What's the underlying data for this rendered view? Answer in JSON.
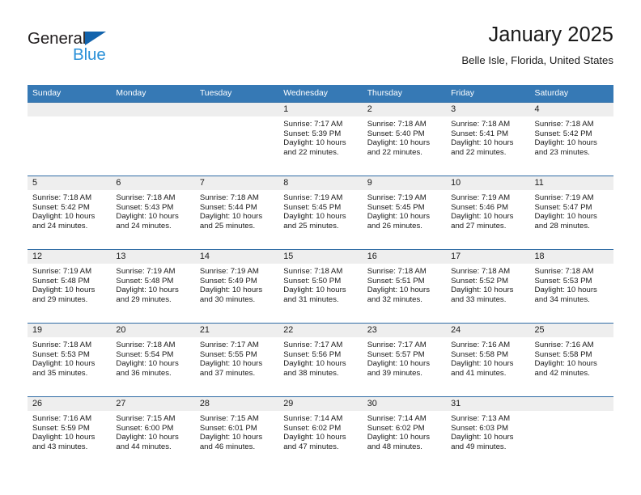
{
  "logo": {
    "word_top": "General",
    "word_bottom": "Blue",
    "triangle_color": "#1263ac",
    "blue_color": "#2a90d8"
  },
  "header": {
    "title": "January 2025",
    "subtitle": "Belle Isle, Florida, United States"
  },
  "theme": {
    "header_blue": "#3679b5",
    "row_border_blue": "#2f6ca5",
    "day_band_gray": "#eeeeee"
  },
  "weekday_headers": [
    "Sunday",
    "Monday",
    "Tuesday",
    "Wednesday",
    "Thursday",
    "Friday",
    "Saturday"
  ],
  "weeks": [
    [
      {
        "day": "",
        "sunrise": "",
        "sunset": "",
        "daylight_line1": "",
        "daylight_line2": ""
      },
      {
        "day": "",
        "sunrise": "",
        "sunset": "",
        "daylight_line1": "",
        "daylight_line2": ""
      },
      {
        "day": "",
        "sunrise": "",
        "sunset": "",
        "daylight_line1": "",
        "daylight_line2": ""
      },
      {
        "day": "1",
        "sunrise": "Sunrise: 7:17 AM",
        "sunset": "Sunset: 5:39 PM",
        "daylight_line1": "Daylight: 10 hours",
        "daylight_line2": "and 22 minutes."
      },
      {
        "day": "2",
        "sunrise": "Sunrise: 7:18 AM",
        "sunset": "Sunset: 5:40 PM",
        "daylight_line1": "Daylight: 10 hours",
        "daylight_line2": "and 22 minutes."
      },
      {
        "day": "3",
        "sunrise": "Sunrise: 7:18 AM",
        "sunset": "Sunset: 5:41 PM",
        "daylight_line1": "Daylight: 10 hours",
        "daylight_line2": "and 22 minutes."
      },
      {
        "day": "4",
        "sunrise": "Sunrise: 7:18 AM",
        "sunset": "Sunset: 5:42 PM",
        "daylight_line1": "Daylight: 10 hours",
        "daylight_line2": "and 23 minutes."
      }
    ],
    [
      {
        "day": "5",
        "sunrise": "Sunrise: 7:18 AM",
        "sunset": "Sunset: 5:42 PM",
        "daylight_line1": "Daylight: 10 hours",
        "daylight_line2": "and 24 minutes."
      },
      {
        "day": "6",
        "sunrise": "Sunrise: 7:18 AM",
        "sunset": "Sunset: 5:43 PM",
        "daylight_line1": "Daylight: 10 hours",
        "daylight_line2": "and 24 minutes."
      },
      {
        "day": "7",
        "sunrise": "Sunrise: 7:18 AM",
        "sunset": "Sunset: 5:44 PM",
        "daylight_line1": "Daylight: 10 hours",
        "daylight_line2": "and 25 minutes."
      },
      {
        "day": "8",
        "sunrise": "Sunrise: 7:19 AM",
        "sunset": "Sunset: 5:45 PM",
        "daylight_line1": "Daylight: 10 hours",
        "daylight_line2": "and 25 minutes."
      },
      {
        "day": "9",
        "sunrise": "Sunrise: 7:19 AM",
        "sunset": "Sunset: 5:45 PM",
        "daylight_line1": "Daylight: 10 hours",
        "daylight_line2": "and 26 minutes."
      },
      {
        "day": "10",
        "sunrise": "Sunrise: 7:19 AM",
        "sunset": "Sunset: 5:46 PM",
        "daylight_line1": "Daylight: 10 hours",
        "daylight_line2": "and 27 minutes."
      },
      {
        "day": "11",
        "sunrise": "Sunrise: 7:19 AM",
        "sunset": "Sunset: 5:47 PM",
        "daylight_line1": "Daylight: 10 hours",
        "daylight_line2": "and 28 minutes."
      }
    ],
    [
      {
        "day": "12",
        "sunrise": "Sunrise: 7:19 AM",
        "sunset": "Sunset: 5:48 PM",
        "daylight_line1": "Daylight: 10 hours",
        "daylight_line2": "and 29 minutes."
      },
      {
        "day": "13",
        "sunrise": "Sunrise: 7:19 AM",
        "sunset": "Sunset: 5:48 PM",
        "daylight_line1": "Daylight: 10 hours",
        "daylight_line2": "and 29 minutes."
      },
      {
        "day": "14",
        "sunrise": "Sunrise: 7:19 AM",
        "sunset": "Sunset: 5:49 PM",
        "daylight_line1": "Daylight: 10 hours",
        "daylight_line2": "and 30 minutes."
      },
      {
        "day": "15",
        "sunrise": "Sunrise: 7:18 AM",
        "sunset": "Sunset: 5:50 PM",
        "daylight_line1": "Daylight: 10 hours",
        "daylight_line2": "and 31 minutes."
      },
      {
        "day": "16",
        "sunrise": "Sunrise: 7:18 AM",
        "sunset": "Sunset: 5:51 PM",
        "daylight_line1": "Daylight: 10 hours",
        "daylight_line2": "and 32 minutes."
      },
      {
        "day": "17",
        "sunrise": "Sunrise: 7:18 AM",
        "sunset": "Sunset: 5:52 PM",
        "daylight_line1": "Daylight: 10 hours",
        "daylight_line2": "and 33 minutes."
      },
      {
        "day": "18",
        "sunrise": "Sunrise: 7:18 AM",
        "sunset": "Sunset: 5:53 PM",
        "daylight_line1": "Daylight: 10 hours",
        "daylight_line2": "and 34 minutes."
      }
    ],
    [
      {
        "day": "19",
        "sunrise": "Sunrise: 7:18 AM",
        "sunset": "Sunset: 5:53 PM",
        "daylight_line1": "Daylight: 10 hours",
        "daylight_line2": "and 35 minutes."
      },
      {
        "day": "20",
        "sunrise": "Sunrise: 7:18 AM",
        "sunset": "Sunset: 5:54 PM",
        "daylight_line1": "Daylight: 10 hours",
        "daylight_line2": "and 36 minutes."
      },
      {
        "day": "21",
        "sunrise": "Sunrise: 7:17 AM",
        "sunset": "Sunset: 5:55 PM",
        "daylight_line1": "Daylight: 10 hours",
        "daylight_line2": "and 37 minutes."
      },
      {
        "day": "22",
        "sunrise": "Sunrise: 7:17 AM",
        "sunset": "Sunset: 5:56 PM",
        "daylight_line1": "Daylight: 10 hours",
        "daylight_line2": "and 38 minutes."
      },
      {
        "day": "23",
        "sunrise": "Sunrise: 7:17 AM",
        "sunset": "Sunset: 5:57 PM",
        "daylight_line1": "Daylight: 10 hours",
        "daylight_line2": "and 39 minutes."
      },
      {
        "day": "24",
        "sunrise": "Sunrise: 7:16 AM",
        "sunset": "Sunset: 5:58 PM",
        "daylight_line1": "Daylight: 10 hours",
        "daylight_line2": "and 41 minutes."
      },
      {
        "day": "25",
        "sunrise": "Sunrise: 7:16 AM",
        "sunset": "Sunset: 5:58 PM",
        "daylight_line1": "Daylight: 10 hours",
        "daylight_line2": "and 42 minutes."
      }
    ],
    [
      {
        "day": "26",
        "sunrise": "Sunrise: 7:16 AM",
        "sunset": "Sunset: 5:59 PM",
        "daylight_line1": "Daylight: 10 hours",
        "daylight_line2": "and 43 minutes."
      },
      {
        "day": "27",
        "sunrise": "Sunrise: 7:15 AM",
        "sunset": "Sunset: 6:00 PM",
        "daylight_line1": "Daylight: 10 hours",
        "daylight_line2": "and 44 minutes."
      },
      {
        "day": "28",
        "sunrise": "Sunrise: 7:15 AM",
        "sunset": "Sunset: 6:01 PM",
        "daylight_line1": "Daylight: 10 hours",
        "daylight_line2": "and 46 minutes."
      },
      {
        "day": "29",
        "sunrise": "Sunrise: 7:14 AM",
        "sunset": "Sunset: 6:02 PM",
        "daylight_line1": "Daylight: 10 hours",
        "daylight_line2": "and 47 minutes."
      },
      {
        "day": "30",
        "sunrise": "Sunrise: 7:14 AM",
        "sunset": "Sunset: 6:02 PM",
        "daylight_line1": "Daylight: 10 hours",
        "daylight_line2": "and 48 minutes."
      },
      {
        "day": "31",
        "sunrise": "Sunrise: 7:13 AM",
        "sunset": "Sunset: 6:03 PM",
        "daylight_line1": "Daylight: 10 hours",
        "daylight_line2": "and 49 minutes."
      },
      {
        "day": "",
        "sunrise": "",
        "sunset": "",
        "daylight_line1": "",
        "daylight_line2": ""
      }
    ]
  ]
}
